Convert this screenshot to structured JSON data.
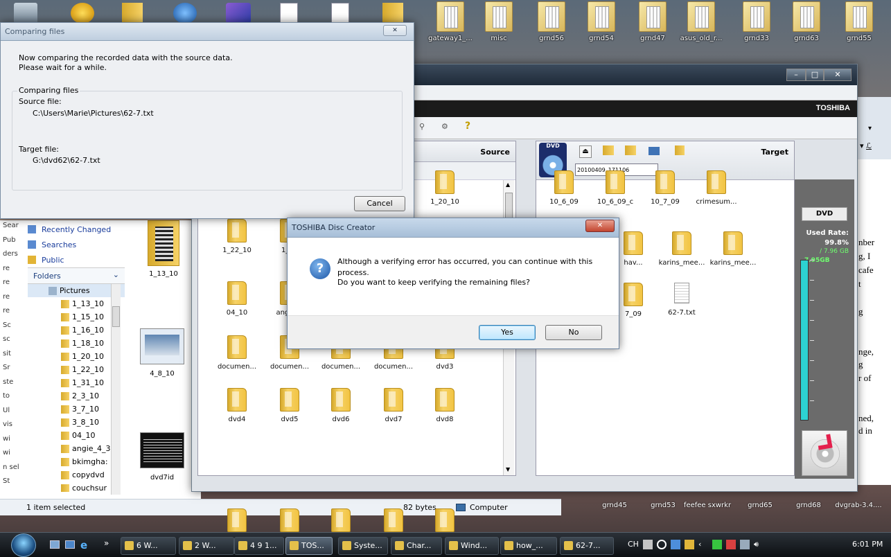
{
  "desktop_icons": [
    "gateway1_...",
    "misc",
    "grnd56",
    "grnd54",
    "grnd47",
    "asus_old_r...",
    "grnd33",
    "grnd63",
    "grnd55"
  ],
  "desktop_icons_bottom": [
    "grnd45",
    "grnd53",
    "feefee sxwrkr",
    "grnd65",
    "grnd68",
    "dvgrab-3.4...."
  ],
  "compare_dialog": {
    "title": "Comparing files",
    "close_glyph": "✕",
    "line1": "Now comparing the recorded data with the source data.",
    "line2": "Please wait for a while.",
    "group_label": "Comparing files",
    "source_label": "Source file:",
    "source_path": "C:\\Users\\Marie\\Pictures\\62-7.txt",
    "target_label": "Target file:",
    "target_path": "G:\\dvd62\\62-7.txt",
    "cancel": "Cancel"
  },
  "explorer": {
    "sidebar_links": [
      "Recently Changed",
      "Searches",
      "Public"
    ],
    "left_edge_labels": [
      "Sear",
      "Pub",
      "ders",
      "re",
      "re",
      "re",
      "re",
      "Sc",
      "sc",
      "sit",
      "Sr",
      "ste",
      "to",
      "Ul",
      "vis",
      "wi",
      "wi",
      "n sel",
      "St"
    ],
    "folders_label": "Folders",
    "tree": [
      "Pictures",
      "1_13_10",
      "1_15_10",
      "1_16_10",
      "1_18_10",
      "1_20_10",
      "1_22_10",
      "1_31_10",
      "2_3_10",
      "3_7_10",
      "3_8_10",
      "04_10",
      "angie_4_3",
      "bkimgha:",
      "copydvd",
      "couchsur"
    ],
    "thumbs": [
      "1_13_10",
      "4_8_10",
      "dvd7id"
    ],
    "status_selected": "1 item selected",
    "status_size": "82 bytes",
    "status_location": "Computer"
  },
  "disc_creator": {
    "brand": "TOSHIBA",
    "source_label": "Source",
    "target_label": "Target",
    "disc_name": "20100409_171106",
    "dvd_badge": "DVD",
    "used_rate_label": "Used Rate:",
    "used_rate_value": "99.8%",
    "used_size": "/ 7.96 GB",
    "capacity": "7.95GB",
    "source_items": [
      "1_20_10",
      "1_22_10",
      "1_31",
      "04_10",
      "angie_4",
      "documen...",
      "documen...",
      "documen...",
      "documen...",
      "dvd3",
      "dvd4",
      "dvd5",
      "dvd6",
      "dvd7",
      "dvd8"
    ],
    "target_items": [
      "10_6_09",
      "10_6_09_c",
      "10_7_09",
      "crimesum...",
      "hav...",
      "karins_mee...",
      "karins_mee...",
      "7_09",
      "62-7.txt"
    ]
  },
  "alert": {
    "title": "TOSHIBA Disc Creator",
    "close_glyph": "✕",
    "message_line1": "Although a verifying error has occurred, you can continue with this",
    "message_line2": "process.",
    "message_line3": "Do you want to keep verifying the remaining files?",
    "yes": "Yes",
    "no": "No",
    "icon": "question-icon"
  },
  "right_doc_fragments": [
    "nber",
    "g, I",
    "cafe",
    "t",
    "g",
    "nge,",
    "g",
    "r of",
    "ned,",
    "d in"
  ],
  "taskbar": {
    "buttons": [
      "6 W...",
      "2 W...",
      "4 9 1...",
      "TOS...",
      "Syste...",
      "Char...",
      "Wind...",
      "how_...",
      "62-7..."
    ],
    "lang": "CH",
    "clock": "6:01 PM"
  }
}
